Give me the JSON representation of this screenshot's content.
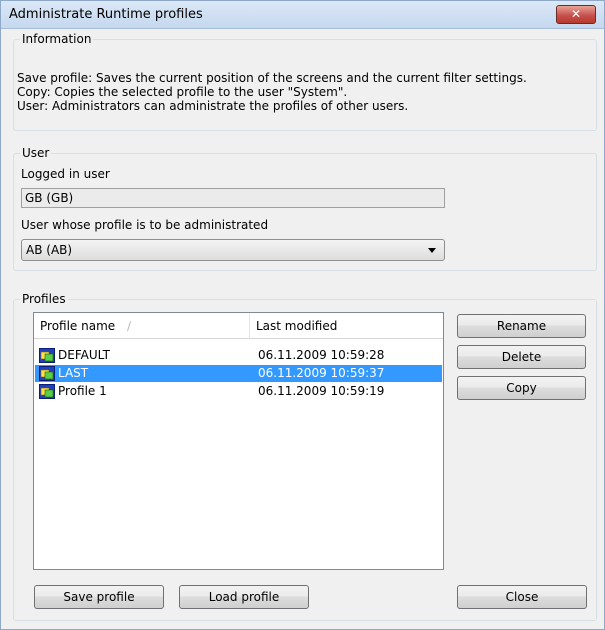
{
  "window": {
    "title": "Administrate Runtime profiles",
    "close_glyph": "✕"
  },
  "information": {
    "title": "Information",
    "lines": [
      "Save profile: Saves the current position of the screens and the current filter settings.",
      "Copy: Copies the selected profile to the user \"System\".",
      "User: Administrators can administrate the profiles of other users."
    ]
  },
  "user": {
    "title": "User",
    "logged_in_label": "Logged in user",
    "logged_in_value": "GB (GB)",
    "administrated_label": "User whose profile is to be administrated",
    "administrated_value": "AB (AB)"
  },
  "profiles": {
    "title": "Profiles",
    "columns": [
      "Profile name",
      "Last modified"
    ],
    "rows": [
      {
        "name": "DEFAULT",
        "modified": "06.11.2009  10:59:28",
        "selected": false
      },
      {
        "name": "LAST",
        "modified": "06.11.2009  10:59:37",
        "selected": true
      },
      {
        "name": "Profile 1",
        "modified": "06.11.2009  10:59:19",
        "selected": false
      }
    ],
    "row_icon": "profile-window-icon"
  },
  "buttons": {
    "rename": "Rename",
    "delete": "Delete",
    "copy": "Copy",
    "save_profile": "Save profile",
    "load_profile": "Load profile",
    "close": "Close"
  },
  "colors": {
    "selection": "#3399ff",
    "title_bar": "#c5d8ee",
    "close_button": "#c75050"
  }
}
